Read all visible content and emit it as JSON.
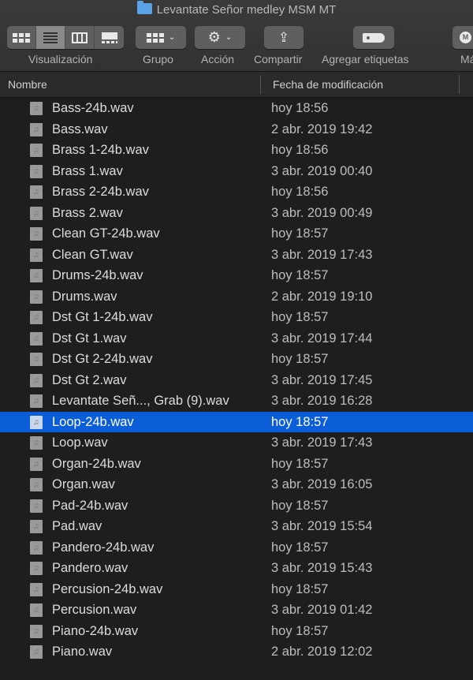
{
  "window": {
    "title": "Levantate Señor medley MSM MT"
  },
  "toolbar": {
    "view_label": "Visualización",
    "group_label": "Grupo",
    "action_label": "Acción",
    "share_label": "Compartir",
    "tags_label": "Agregar etiquetas",
    "more_label": "Má",
    "active_view": "list"
  },
  "columns": {
    "name": "Nombre",
    "date": "Fecha de modificación"
  },
  "files": [
    {
      "name": "Bass-24b.wav",
      "date": "hoy 18:56"
    },
    {
      "name": "Bass.wav",
      "date": "2 abr. 2019 19:42"
    },
    {
      "name": "Brass 1-24b.wav",
      "date": "hoy 18:56"
    },
    {
      "name": "Brass 1.wav",
      "date": "3 abr. 2019 00:40"
    },
    {
      "name": "Brass 2-24b.wav",
      "date": "hoy 18:56"
    },
    {
      "name": "Brass 2.wav",
      "date": "3 abr. 2019 00:49"
    },
    {
      "name": "Clean GT-24b.wav",
      "date": "hoy 18:57"
    },
    {
      "name": "Clean GT.wav",
      "date": "3 abr. 2019 17:43"
    },
    {
      "name": "Drums-24b.wav",
      "date": "hoy 18:57"
    },
    {
      "name": "Drums.wav",
      "date": "2 abr. 2019 19:10"
    },
    {
      "name": "Dst Gt 1-24b.wav",
      "date": "hoy 18:57"
    },
    {
      "name": "Dst Gt 1.wav",
      "date": "3 abr. 2019 17:44"
    },
    {
      "name": "Dst Gt 2-24b.wav",
      "date": "hoy 18:57"
    },
    {
      "name": "Dst Gt 2.wav",
      "date": "3 abr. 2019 17:45"
    },
    {
      "name": "Levantate Señ..., Grab (9).wav",
      "date": "3 abr. 2019 16:28"
    },
    {
      "name": "Loop-24b.wav",
      "date": "hoy 18:57",
      "selected": true
    },
    {
      "name": "Loop.wav",
      "date": "3 abr. 2019 17:43"
    },
    {
      "name": "Organ-24b.wav",
      "date": "hoy 18:57"
    },
    {
      "name": "Organ.wav",
      "date": "3 abr. 2019 16:05"
    },
    {
      "name": "Pad-24b.wav",
      "date": "hoy 18:57"
    },
    {
      "name": "Pad.wav",
      "date": "3 abr. 2019 15:54"
    },
    {
      "name": "Pandero-24b.wav",
      "date": "hoy 18:57"
    },
    {
      "name": "Pandero.wav",
      "date": "3 abr. 2019 15:43"
    },
    {
      "name": "Percusion-24b.wav",
      "date": "hoy 18:57"
    },
    {
      "name": "Percusion.wav",
      "date": "3 abr. 2019 01:42"
    },
    {
      "name": "Piano-24b.wav",
      "date": "hoy 18:57"
    },
    {
      "name": "Piano.wav",
      "date": "2 abr. 2019 12:02"
    }
  ],
  "icons": {
    "folder": "folder-icon",
    "file": "audio-file-icon"
  },
  "colors": {
    "selection": "#0b5ed8",
    "folder": "#5aa3e6",
    "background": "#1e1e1e"
  }
}
